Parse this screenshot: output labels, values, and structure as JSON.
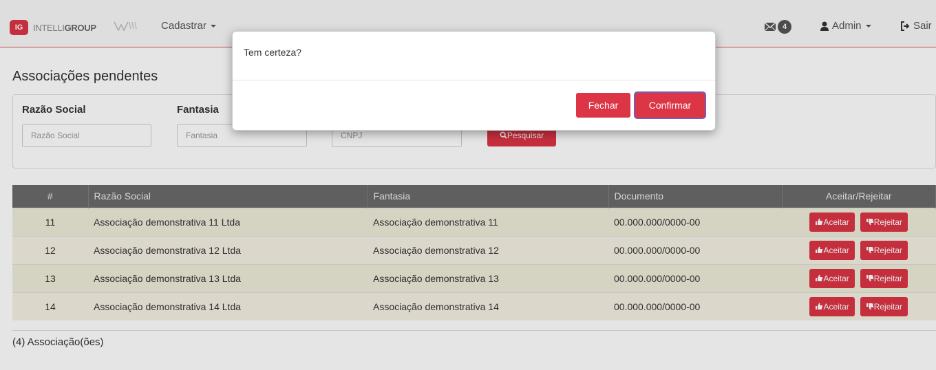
{
  "navbar": {
    "logo_mark": "IG",
    "brand_prefix": "INTELLI",
    "brand_suffix": "GROUP",
    "cadastrar_label": "Cadastrar",
    "messages_count": "4",
    "admin_label": "Admin",
    "logout_label": "Sair"
  },
  "page": {
    "title": "Associações pendentes"
  },
  "filters": {
    "razao_label": "Razão Social",
    "razao_placeholder": "Razão Social",
    "fantasia_label": "Fantasia",
    "fantasia_placeholder": "Fantasia",
    "cnpj_placeholder": "CNPJ",
    "search_label": "Pesquisar"
  },
  "table": {
    "headers": [
      "#",
      "Razão Social",
      "Fantasia",
      "Documento",
      "Aceitar/Rejeitar"
    ],
    "rows": [
      {
        "id": "11",
        "razao": "Associação demonstrativa 11 Ltda",
        "fantasia": "Associação demonstrativa 11",
        "documento": "00.000.000/0000-00"
      },
      {
        "id": "12",
        "razao": "Associação demonstrativa 12 Ltda",
        "fantasia": "Associação demonstrativa 12",
        "documento": "00.000.000/0000-00"
      },
      {
        "id": "13",
        "razao": "Associação demonstrativa 13 Ltda",
        "fantasia": "Associação demonstrativa 13",
        "documento": "00.000.000/0000-00"
      },
      {
        "id": "14",
        "razao": "Associação demonstrativa 14 Ltda",
        "fantasia": "Associação demonstrativa 14",
        "documento": "00.000.000/0000-00"
      }
    ],
    "accept_label": "Aceitar",
    "reject_label": "Rejeitar"
  },
  "footer": {
    "count_text": "(4) Associação(ões)"
  },
  "modal": {
    "message": "Tem certeza?",
    "close_label": "Fechar",
    "confirm_label": "Confirmar"
  },
  "colors": {
    "accent": "#dc3545",
    "table_header": "#6a6a6a",
    "row_background": "#f4f1e2"
  },
  "icons": [
    "envelope-icon",
    "user-icon",
    "sign-out-icon",
    "search-icon",
    "thumbs-up-icon",
    "thumbs-down-icon"
  ]
}
